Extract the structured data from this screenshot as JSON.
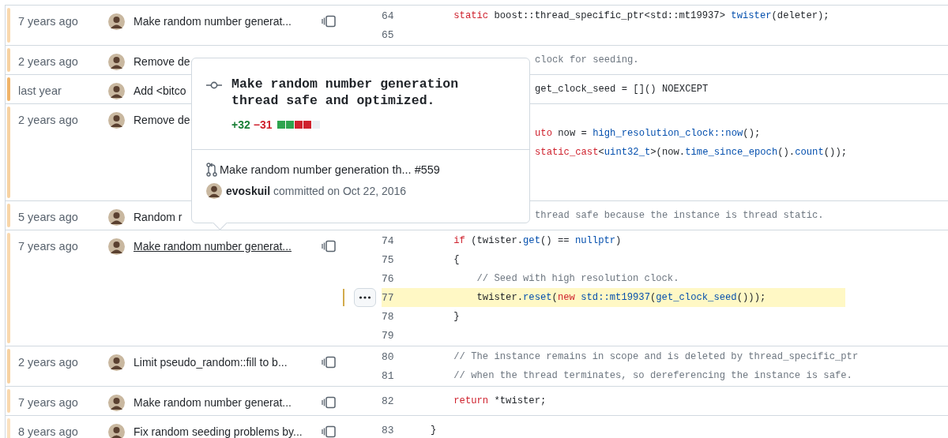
{
  "rows": [
    {
      "age": "7 years ago",
      "color": "#f9d8ae",
      "message": "Make random number generat...",
      "hovered": false,
      "covered": false,
      "lines": [
        {
          "number": "64",
          "covered": false,
          "highlighted": false,
          "tokens": [
            {
              "kind": "keyword",
              "text": "    static"
            },
            {
              "kind": "plain",
              "text": " boost::thread_specific_ptr<std::mt19937> "
            },
            {
              "kind": "entity",
              "text": "twister"
            },
            {
              "kind": "plain",
              "text": "(deleter);"
            }
          ]
        },
        {
          "number": "65",
          "covered": false,
          "highlighted": false
        }
      ]
    },
    {
      "age": "2 years ago",
      "color": "#f7d2a2",
      "message": "Remove de",
      "hovered": false,
      "covered": true,
      "lines": [
        {
          "covered": true,
          "highlighted": false,
          "tokens": [
            {
              "kind": "comment",
              "text": "clock for seeding."
            }
          ]
        }
      ]
    },
    {
      "age": "last year",
      "color": "#f0b46a",
      "message": "Add <bitco",
      "hovered": false,
      "covered": true,
      "lines": [
        {
          "covered": true,
          "highlighted": false,
          "tokens": [
            {
              "kind": "plain",
              "text": "get_clock_seed = []() NOEXCEPT"
            }
          ]
        }
      ]
    },
    {
      "age": "2 years ago",
      "color": "#f7d2a2",
      "message": "Remove de",
      "hovered": false,
      "covered": true,
      "lines": [
        {
          "highlighted": false
        },
        {
          "covered": true,
          "highlighted": false,
          "tokens": [
            {
              "kind": "keyword",
              "text": "uto"
            },
            {
              "kind": "plain",
              "text": " now = "
            },
            {
              "kind": "entity",
              "text": "high_resolution_clock::now"
            },
            {
              "kind": "plain",
              "text": "();"
            }
          ]
        },
        {
          "covered": true,
          "highlighted": false,
          "tokens": [
            {
              "kind": "keyword",
              "text": "static_cast"
            },
            {
              "kind": "plain",
              "text": "<"
            },
            {
              "kind": "entity",
              "text": "uint32_t"
            },
            {
              "kind": "plain",
              "text": ">(now."
            },
            {
              "kind": "entity",
              "text": "time_since_epoch"
            },
            {
              "kind": "plain",
              "text": "()."
            },
            {
              "kind": "entity",
              "text": "count"
            },
            {
              "kind": "plain",
              "text": "());"
            }
          ]
        },
        {
          "highlighted": false
        },
        {
          "highlighted": false
        }
      ]
    },
    {
      "age": "5 years ago",
      "color": "#f8d5a8",
      "message": "Random r",
      "hovered": false,
      "covered": true,
      "lines": [
        {
          "covered": true,
          "highlighted": false,
          "tokens": [
            {
              "kind": "comment",
              "text": "thread safe because the instance is thread static."
            }
          ]
        }
      ]
    },
    {
      "age": "7 years ago",
      "color": "#f9d8ae",
      "message": "Make random number generat...",
      "hovered": true,
      "covered": false,
      "lines": [
        {
          "number": "74",
          "covered": false,
          "highlighted": false,
          "tokens": [
            {
              "kind": "keyword",
              "text": "    if"
            },
            {
              "kind": "plain",
              "text": " (twister."
            },
            {
              "kind": "entity",
              "text": "get"
            },
            {
              "kind": "plain",
              "text": "() == "
            },
            {
              "kind": "entity",
              "text": "nullptr"
            },
            {
              "kind": "plain",
              "text": ")"
            }
          ]
        },
        {
          "number": "75",
          "covered": false,
          "highlighted": false,
          "tokens": [
            {
              "kind": "plain",
              "text": "    {"
            }
          ]
        },
        {
          "number": "76",
          "covered": false,
          "highlighted": false,
          "tokens": [
            {
              "kind": "comment",
              "text": "        // Seed with high resolution clock."
            }
          ]
        },
        {
          "number": "77",
          "covered": false,
          "highlighted": true,
          "tokens": [
            {
              "kind": "plain",
              "text": "        twister."
            },
            {
              "kind": "entity",
              "text": "reset"
            },
            {
              "kind": "plain",
              "text": "("
            },
            {
              "kind": "keyword",
              "text": "new "
            },
            {
              "kind": "entity",
              "text": "std::mt19937"
            },
            {
              "kind": "plain",
              "text": "("
            },
            {
              "kind": "entity",
              "text": "get_clock_seed"
            },
            {
              "kind": "plain",
              "text": "()));"
            }
          ]
        },
        {
          "number": "78",
          "covered": false,
          "highlighted": false,
          "tokens": [
            {
              "kind": "plain",
              "text": "    }"
            }
          ]
        },
        {
          "number": "79",
          "covered": false,
          "highlighted": false
        }
      ]
    },
    {
      "age": "2 years ago",
      "color": "#f7d2a2",
      "message": "Limit pseudo_random::fill to b...",
      "hovered": false,
      "covered": false,
      "lines": [
        {
          "number": "80",
          "covered": false,
          "highlighted": false,
          "tokens": [
            {
              "kind": "comment",
              "text": "    // The instance remains in scope and is deleted by thread_specific_ptr"
            }
          ]
        },
        {
          "number": "81",
          "covered": false,
          "highlighted": false,
          "tokens": [
            {
              "kind": "comment",
              "text": "    // when the thread terminates, so dereferencing the instance is safe."
            }
          ]
        }
      ]
    },
    {
      "age": "7 years ago",
      "color": "#f9d8ae",
      "message": "Make random number generat...",
      "hovered": false,
      "covered": false,
      "lines": [
        {
          "number": "82",
          "covered": false,
          "highlighted": false,
          "tokens": [
            {
              "kind": "keyword",
              "text": "    return"
            },
            {
              "kind": "plain",
              "text": " *twister;"
            }
          ]
        }
      ]
    },
    {
      "age": "8 years ago",
      "color": "#fbe1c0",
      "message": "Fix random seeding problems by...",
      "hovered": false,
      "covered": false,
      "lines": [
        {
          "number": "83",
          "covered": false,
          "highlighted": false,
          "tokens": [
            {
              "kind": "plain",
              "text": "}"
            }
          ]
        }
      ]
    }
  ],
  "popover": {
    "title": "Make random number generation thread safe and optimized.",
    "additions": "+32",
    "deletions": "−31",
    "diffstat": [
      {
        "kind": "added"
      },
      {
        "kind": "added"
      },
      {
        "kind": "deleted"
      },
      {
        "kind": "deleted"
      },
      {
        "kind": "neutral"
      }
    ],
    "pull_request": {
      "title": "Make random number generation th... #559"
    },
    "author": "evoskuil",
    "committed": "committed on Oct 22, 2016"
  }
}
